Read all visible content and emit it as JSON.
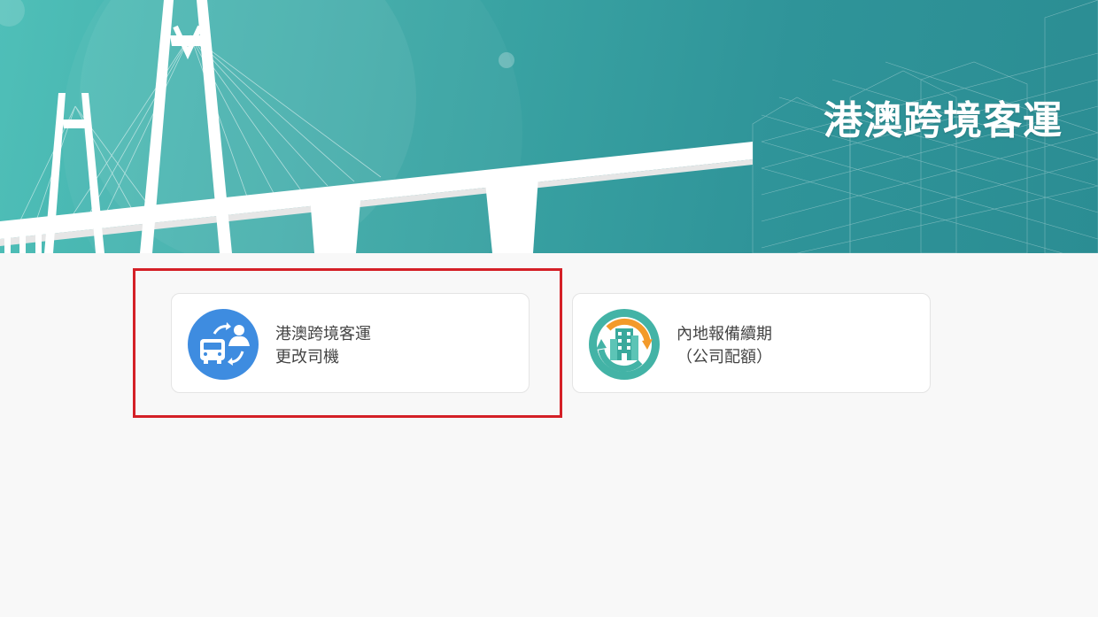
{
  "banner": {
    "title": "港澳跨境客運"
  },
  "cards": [
    {
      "line1": "港澳跨境客運",
      "line2": "更改司機",
      "icon": "bus-driver-swap-icon",
      "icon_color": "#3e8ce0"
    },
    {
      "line1": "內地報備續期",
      "line2": "（公司配額）",
      "icon": "building-renew-icon",
      "icon_color": "#43b3a6"
    }
  ],
  "colors": {
    "banner_teal": "#3da8a6",
    "highlight_red": "#d42027",
    "page_background": "#f8f8f8"
  }
}
